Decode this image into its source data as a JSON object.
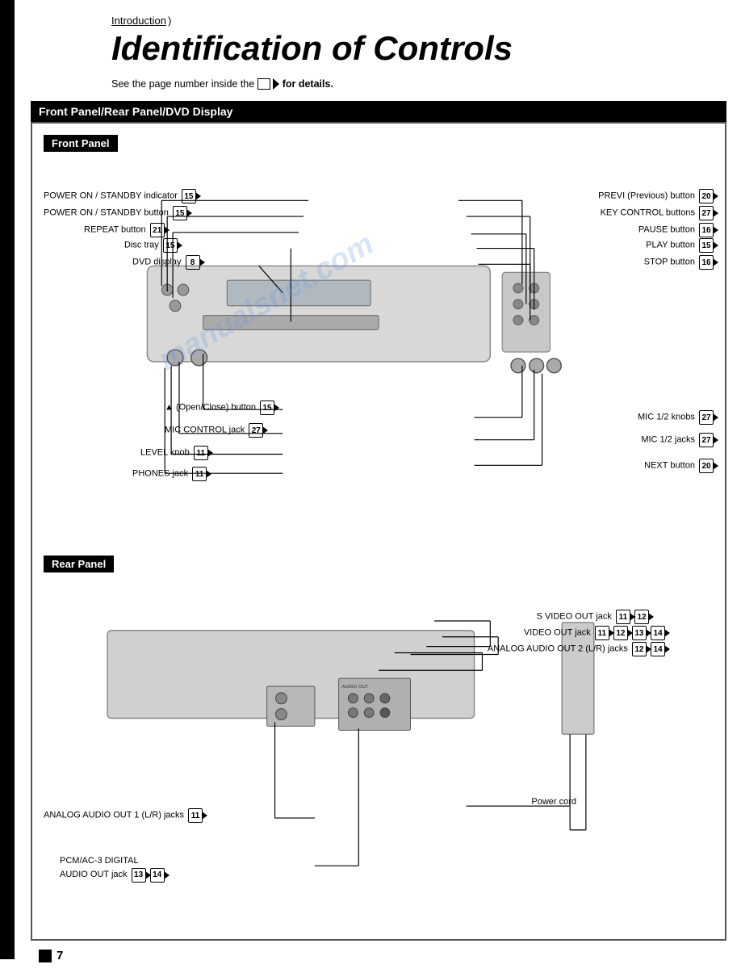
{
  "breadcrumb": {
    "label": "Introduction",
    "arrow": ")"
  },
  "title": "Identification of Controls",
  "subtitle": {
    "prefix": "See the page number inside the",
    "suffix": "for details."
  },
  "section_header": "Front Panel/Rear Panel/DVD Display",
  "front_panel": {
    "label": "Front Panel",
    "callouts_left": [
      {
        "id": "power-indicator",
        "text": "POWER ON / STANDBY indicator",
        "page": "15"
      },
      {
        "id": "power-button",
        "text": "POWER ON / STANDBY button",
        "page": "15"
      },
      {
        "id": "repeat-button",
        "text": "REPEAT button",
        "page": "21"
      },
      {
        "id": "disc-tray",
        "text": "Disc tray",
        "page": "15"
      },
      {
        "id": "dvd-display",
        "text": "DVD display",
        "page": "8"
      }
    ],
    "callouts_right": [
      {
        "id": "prev-button",
        "text": "PREVI (Previous) button",
        "page": "20"
      },
      {
        "id": "key-control",
        "text": "KEY CONTROL buttons",
        "page": "27"
      },
      {
        "id": "pause-button",
        "text": "PAUSE button",
        "page": "16"
      },
      {
        "id": "play-button",
        "text": "PLAY button",
        "page": "15"
      },
      {
        "id": "stop-button",
        "text": "STOP button",
        "page": "16"
      }
    ],
    "callouts_bottom_left": [
      {
        "id": "open-close",
        "text": "▲ (Open/Close) button",
        "page": "15"
      },
      {
        "id": "mic-control",
        "text": "MIC CONTROL jack",
        "page": "27"
      },
      {
        "id": "level-knob",
        "text": "LEVEL knob",
        "page": "11"
      },
      {
        "id": "phones-jack",
        "text": "PHONES jack",
        "page": "11"
      }
    ],
    "callouts_bottom_right": [
      {
        "id": "mic-knobs",
        "text": "MIC 1/2 knobs",
        "page": "27"
      },
      {
        "id": "mic-jacks",
        "text": "MIC 1/2 jacks",
        "page": "27"
      },
      {
        "id": "next-button",
        "text": "NEXT button",
        "page": "20"
      }
    ]
  },
  "rear_panel": {
    "label": "Rear Panel",
    "callouts": [
      {
        "id": "s-video-out",
        "text": "S VIDEO OUT jack",
        "pages": [
          "11",
          "12"
        ]
      },
      {
        "id": "video-out",
        "text": "VIDEO OUT jack",
        "pages": [
          "11",
          "12",
          "13",
          "14"
        ]
      },
      {
        "id": "analog-audio-2",
        "text": "ANALOG AUDIO OUT 2 (L/R) jacks",
        "pages": [
          "12",
          "14"
        ]
      },
      {
        "id": "analog-audio-1",
        "text": "ANALOG AUDIO OUT 1 (L/R) jacks",
        "pages": [
          "11"
        ]
      },
      {
        "id": "pcm-digital",
        "text": "PCM/AC-3 DIGITAL\nAUDIO OUT jack",
        "pages": [
          "13",
          "14"
        ]
      },
      {
        "id": "power-cord",
        "text": "Power cord",
        "pages": []
      }
    ]
  },
  "page_number": "7",
  "watermark_text": "manualsnet.com"
}
